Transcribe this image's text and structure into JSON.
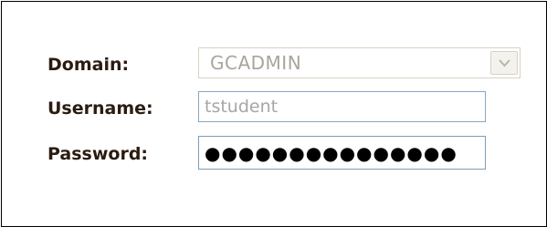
{
  "form": {
    "domain": {
      "label": "Domain:",
      "selected": "GCADMIN"
    },
    "username": {
      "label": "Username:",
      "value": "tstudent"
    },
    "password": {
      "label": "Password:",
      "masked_value": "●●●●●●●●●●●●●●●"
    }
  },
  "icons": {
    "dropdown": "chevron-down-icon"
  },
  "colors": {
    "label_text": "#2b1b10",
    "disabled_text": "#a9a59c",
    "input_border": "#7f9db9"
  }
}
